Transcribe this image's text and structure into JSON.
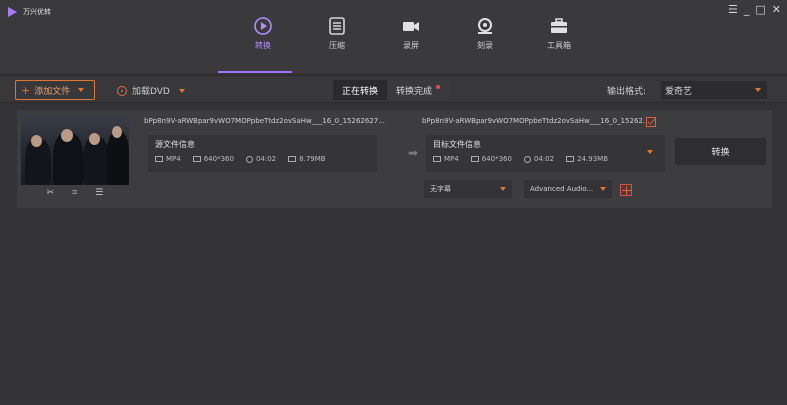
{
  "app": {
    "title": "万兴优转"
  },
  "window_controls": [
    "☰",
    "_",
    "□",
    "✕"
  ],
  "nav": {
    "items": [
      {
        "label": "转换",
        "icon": "play-circle-icon",
        "active": true
      },
      {
        "label": "压缩",
        "icon": "compress-icon"
      },
      {
        "label": "录屏",
        "icon": "camera-icon"
      },
      {
        "label": "刻录",
        "icon": "disc-burn-icon"
      },
      {
        "label": "工具箱",
        "icon": "toolbox-icon"
      }
    ]
  },
  "toolbar": {
    "add_file": "添加文件",
    "load_dvd": "加载DVD",
    "tab_converting": "正在转换",
    "tab_done": "转换完成",
    "output_format_label": "输出格式:",
    "output_format_value": "爱奇艺"
  },
  "file": {
    "source_name": "bPp8n9V-aRWBpar9vWO7MOPpbeTtdz2ovSaHw___16_0_15262627...",
    "target_name": "bPp8n9V-aRWBpar9vWO7MOPpbeTtdz2ovSaHw___16_0_15262...",
    "source_info": {
      "title": "源文件信息",
      "format": "MP4",
      "resolution": "640*360",
      "duration": "04:02",
      "size": "8.79MB"
    },
    "target_info": {
      "title": "目标文件信息",
      "format": "MP4",
      "resolution": "640*360",
      "duration": "04:02",
      "size": "24.93MB"
    },
    "convert_label": "转换",
    "subtitle_option": "无字幕",
    "audio_option": "Advanced Audio..."
  },
  "colors": {
    "accent": "#9c74ff",
    "orange": "#e07632",
    "background": "#333335"
  }
}
